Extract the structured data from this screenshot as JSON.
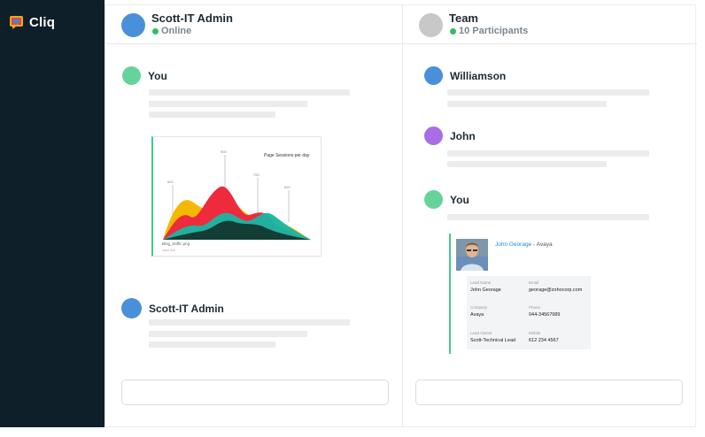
{
  "app": {
    "name": "Cliq"
  },
  "left_pane": {
    "header": {
      "title": "Scott-IT Admin",
      "status": "Online"
    },
    "messages": [
      {
        "sender": "You"
      },
      {
        "sender": "Scott-IT Admin"
      }
    ],
    "attachment": {
      "chart_title": "Page Sessions per day",
      "filename": "Blog_traffic.png",
      "meta": "view link",
      "peak_labels": [
        "820",
        "900",
        "750",
        "620"
      ]
    }
  },
  "right_pane": {
    "header": {
      "title": "Team",
      "status": "10 Participants"
    },
    "messages": [
      {
        "sender": "Williamson"
      },
      {
        "sender": "John"
      },
      {
        "sender": "You"
      }
    ],
    "lead_card": {
      "name": "John Georage",
      "org": " - Avaya",
      "fields": [
        {
          "label": "Lead Name",
          "value": "John Georage"
        },
        {
          "label": "Email",
          "value": "georage@zohocorp.com"
        },
        {
          "label": "Company",
          "value": "Avaya"
        },
        {
          "label": "Phone",
          "value": "044-34567989"
        },
        {
          "label": "Lead Owner",
          "value": "Scott-Technical Lead"
        },
        {
          "label": "Mobile",
          "value": "612 234 4567"
        }
      ]
    }
  },
  "colors": {
    "sidebar": "#0f1f2a",
    "online": "#2fbf5f",
    "avatar_blue": "#4a90d9",
    "avatar_grey": "#c8c8c8",
    "avatar_green": "#66d49a",
    "avatar_purple": "#a86ee6",
    "card_accent": "#44c88b"
  }
}
